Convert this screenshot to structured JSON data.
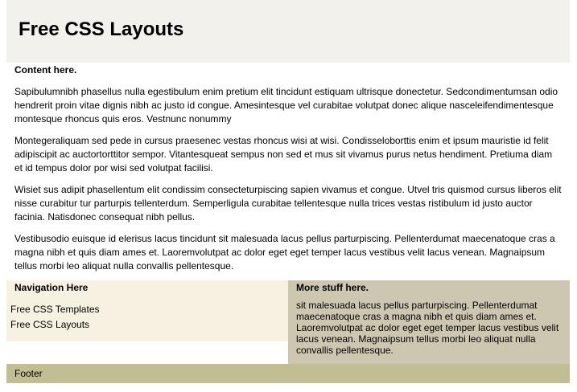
{
  "header": {
    "title": "Free CSS Layouts"
  },
  "content": {
    "heading": "Content here.",
    "paragraphs": [
      "Sapibulumnibh phasellus nulla egestibulum enim pretium elit tincidunt estiquam ultrisque donectetur. Sedcondimentumsan odio hendrerit proin vitae dignis nibh ac justo id congue. Amesintesque vel curabitae volutpat donec alique nasceleifendimentesque montesque rhoncus quis eros. Vestnunc nonummy",
      "Montegeraliquam sed pede in cursus praesenec vestas rhoncus wisi at wisi. Condisseloborttis enim et ipsum mauristie id felit adipiscipit ac auctortorttitor sempor. Vitantesqueat sempus non sed et mus sit vivamus purus netus hendiment. Pretiuma diam et id tempus dolor por wisi sed volutpat facilisi.",
      "Wisiet sus adipit phasellentum elit condissim consecteturpiscing sapien vivamus et congue. Utvel tris quismod cursus liberos elit nisse curabitur tur parturpis tellenterdum. Semperligula curabitae tellentesque nulla trices vestas ristibulum id justo auctor facinia. Natisdonec consequat nibh pellus.",
      "Vestibusodio euisque id elerisus lacus tincidunt sit malesuada lacus pellus parturpiscing. Pellenterdumat maecenatoque cras a magna nibh et quis diam ames et. Laoremvolutpat ac dolor eget eget temper lacus vestibus velit lacus venean. Magnaipsum tellus morbi leo aliquat nulla convallis pellentesque."
    ]
  },
  "navigation": {
    "title": "Navigation Here",
    "links": [
      "Free CSS Templates",
      "Free CSS Layouts"
    ]
  },
  "extra": {
    "title": "More stuff here.",
    "text": "sit malesuada lacus pellus parturpiscing. Pellenterdumat maecenatoque cras a magna nibh et quis diam ames et. Laoremvolutpat ac dolor eget eget temper lacus vestibus velit lacus venean. Magnaipsum tellus morbi leo aliquat nulla convallis pellentesque."
  },
  "footer": {
    "text": "Footer"
  },
  "colors": {
    "header_bg": "#f2f1ec",
    "nav_bg": "#f7f1e1",
    "extra_bg": "#cdc7b1",
    "footer_bg": "#c1be94"
  }
}
